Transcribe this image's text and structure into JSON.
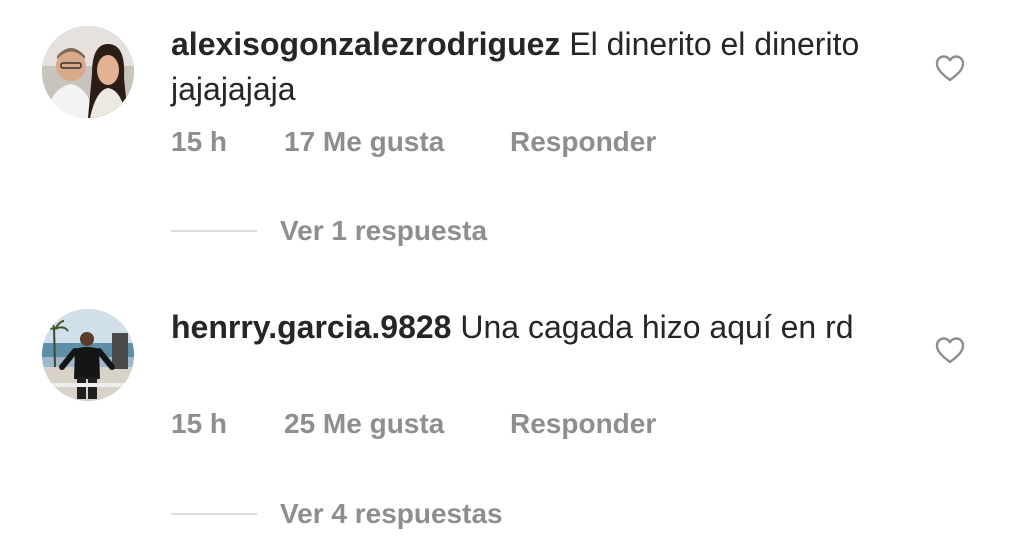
{
  "comments": [
    {
      "username": "alexisogonzalezrodriguez",
      "text": "El dinerito el dinerito jajajajaja",
      "time": "15 h",
      "likes": "17 Me gusta",
      "reply_label": "Responder",
      "view_replies": "Ver 1 respuesta",
      "like_icon": "heart-outline-icon"
    },
    {
      "username": "henrry.garcia.9828",
      "text": "Una cagada hizo aquí en rd",
      "time": "15 h",
      "likes": "25 Me gusta",
      "reply_label": "Responder",
      "view_replies": "Ver 4 respuestas",
      "like_icon": "heart-outline-icon"
    }
  ],
  "colors": {
    "text": "#262626",
    "secondary_text": "#8e8e8e",
    "divider": "#dbdbdb",
    "background": "#ffffff"
  }
}
